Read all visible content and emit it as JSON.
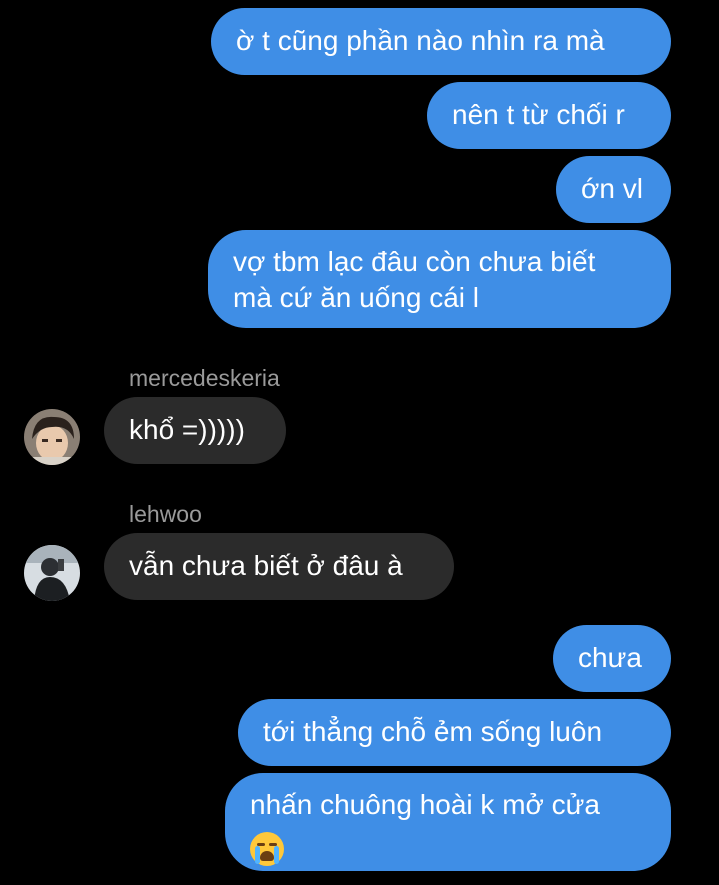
{
  "messages": {
    "m1": "ờ t cũng phần nào nhìn ra mà",
    "m2": "nên t từ chối r",
    "m3": "ớn vl",
    "m4_line1": "vợ tbm lạc đâu còn chưa biết",
    "m4_line2": "mà cứ ăn uống cái l",
    "m5_sender": "mercedeskeria",
    "m5": "khổ =)))))",
    "m6_sender": "lehwoo",
    "m6": "vẫn chưa biết ở đâu à",
    "m7": "chưa",
    "m8": "tới thẳng chỗ ẻm sống luôn",
    "m9": "nhấn chuông hoài k mở cửa"
  },
  "icons": {
    "m9_emoji": "loudly-crying-face-icon",
    "avatar1": "user-avatar-mercedeskeria",
    "avatar2": "user-avatar-lehwoo"
  },
  "colors": {
    "background": "#000000",
    "outgoing_bubble": "#3f8ee6",
    "incoming_bubble": "#2b2b2b",
    "sender_name": "#9a9a9a"
  }
}
